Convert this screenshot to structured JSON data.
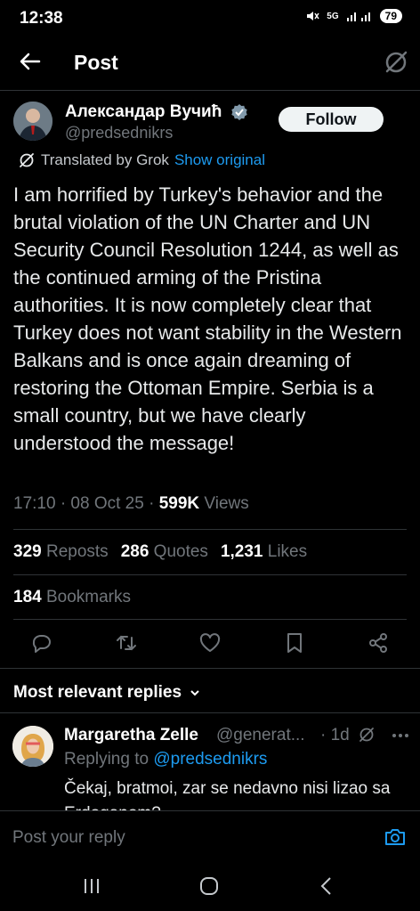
{
  "status_bar": {
    "time": "12:38",
    "battery": "79",
    "network": "5G"
  },
  "header": {
    "title": "Post",
    "back_icon": "arrow-left-icon",
    "grok_icon": "grok-icon"
  },
  "post": {
    "author_name": "Александар Вучић",
    "handle": "@predsednikrs",
    "follow_label": "Follow",
    "translated_label": "Translated by Grok",
    "show_original_label": "Show original",
    "text": "I am horrified by Turkey's behavior and the brutal violation of the UN Charter and UN Security Council Resolution 1244, as well as the continued arming of the Pristina authorities. It is now completely clear that Turkey does not want stability in the Western Balkans and is once again dreaming of restoring the Ottoman Empire. Serbia is a small country, but we have clearly understood the message!",
    "time": "17:10 · 08 Oct 25 · ",
    "views_count": "599K",
    "views_label": " Views",
    "reposts_count": "329",
    "reposts_label": " Reposts",
    "quotes_count": "286",
    "quotes_label": " Quotes",
    "likes_count": "1,231",
    "likes_label": " Likes",
    "bookmarks_count": "184",
    "bookmarks_label": " Bookmarks"
  },
  "replies": {
    "filter_label": "Most relevant replies",
    "items": [
      {
        "name": "Margaretha Zelle",
        "handle": "@generat...",
        "time": "· 1d",
        "replying_prefix": "Replying to ",
        "replying_to": "@predsednikrs",
        "text": "Čekaj, bratmoi, zar se nedavno nisi lizao sa Erdoganom?"
      }
    ]
  },
  "compose": {
    "placeholder": "Post your reply"
  },
  "colors": {
    "accent": "#1d9bf0",
    "background": "#000000",
    "muted": "#71767b",
    "divider": "#2f3336"
  }
}
